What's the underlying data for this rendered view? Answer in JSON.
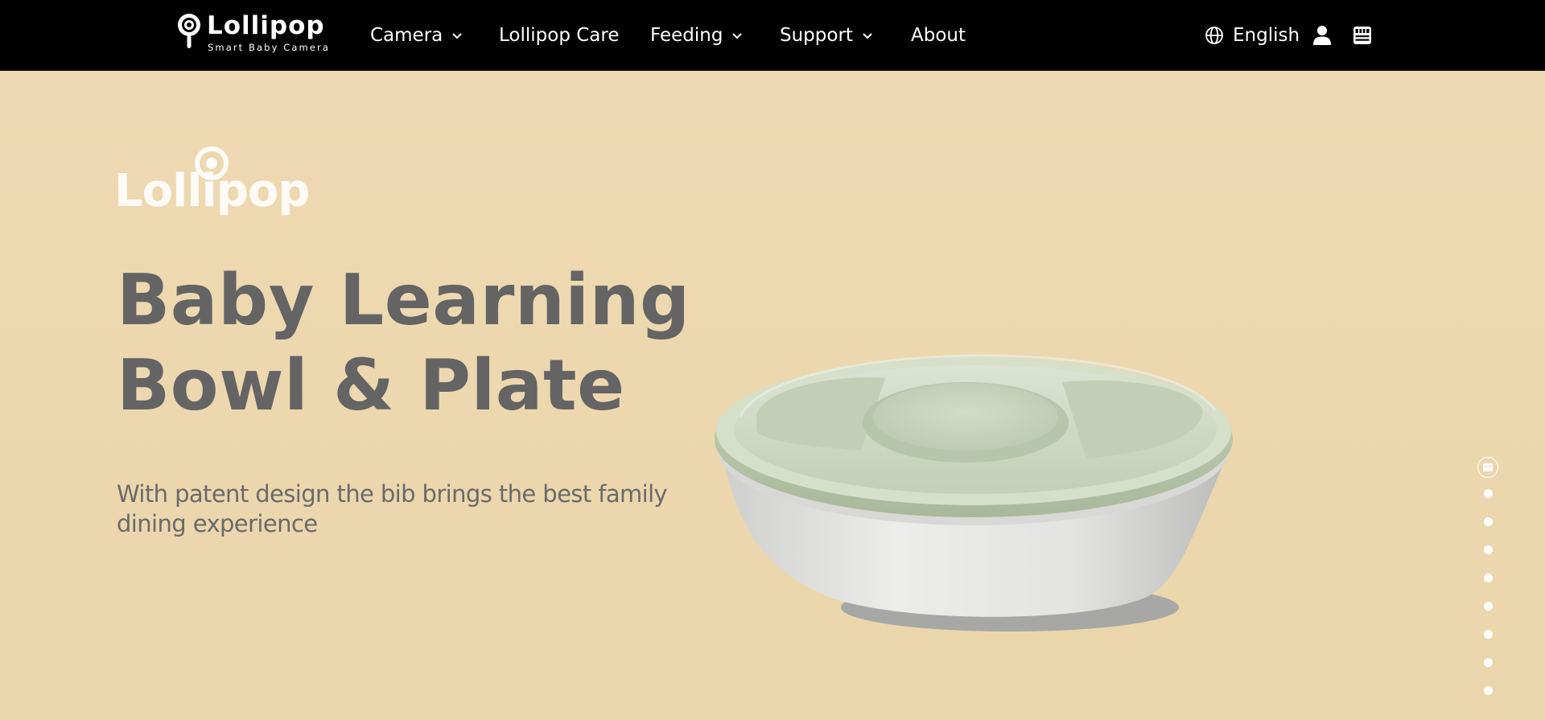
{
  "brand": {
    "name": "Lollipop",
    "tagline": "Smart Baby Camera"
  },
  "nav": {
    "items": [
      {
        "label": "Camera",
        "has_dropdown": true
      },
      {
        "label": "Lollipop Care",
        "has_dropdown": false
      },
      {
        "label": "Feeding",
        "has_dropdown": true
      },
      {
        "label": "Support",
        "has_dropdown": true
      },
      {
        "label": "About",
        "has_dropdown": false
      }
    ],
    "language": "English",
    "icons": [
      "globe-icon",
      "user-icon",
      "store-icon",
      "chevron-down-icon"
    ]
  },
  "hero": {
    "brand_logo": "Lollipop",
    "title_line1": "Baby Learning",
    "title_line2": "Bowl & Plate",
    "subtitle": "With patent design the bib brings the best family dining experience",
    "product_image": "baby-learning-bowl"
  },
  "pager": {
    "total_slides": 9,
    "active_index": 0
  },
  "colors": {
    "nav_bg": "#000000",
    "hero_bg": "#ecd9b1",
    "title": "#646464",
    "bowl_lid": "#cad6bd",
    "bowl_body": "#e8e8e6"
  }
}
